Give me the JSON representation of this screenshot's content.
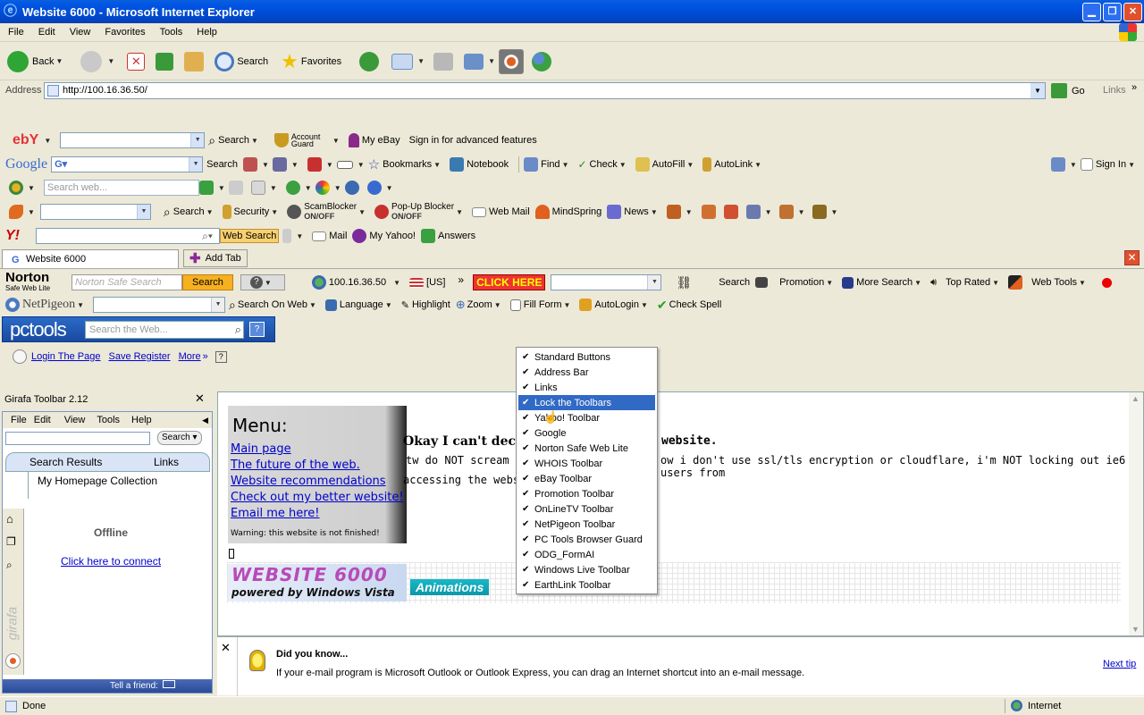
{
  "window": {
    "title": "Website 6000 - Microsoft Internet Explorer"
  },
  "menubar": [
    "File",
    "Edit",
    "View",
    "Favorites",
    "Tools",
    "Help"
  ],
  "std": {
    "back": "Back",
    "search": "Search",
    "favorites": "Favorites"
  },
  "address": {
    "label": "Address",
    "url": "http://100.16.36.50/",
    "go": "Go",
    "links": "Links"
  },
  "ebay": {
    "logo": "ebY",
    "search": "Search",
    "account_guard": "Account Guard",
    "my_ebay": "My eBay",
    "sign_in": "Sign in for advanced features"
  },
  "google": {
    "logo": "Google",
    "search": "Search",
    "bookmarks": "Bookmarks",
    "notebook": "Notebook",
    "find": "Find",
    "check": "Check",
    "autofill": "AutoFill",
    "autolink": "AutoLink",
    "signin": "Sign In"
  },
  "live": {
    "placeholder": "Search web..."
  },
  "earthlink": {
    "search": "Search",
    "security": "Security",
    "scamblocker": "ScamBlocker",
    "scam_state": "ON/OFF",
    "popup": "Pop-Up Blocker",
    "popup_state": "ON/OFF",
    "webmail": "Web Mail",
    "mindspring": "MindSpring",
    "news": "News"
  },
  "yahoo": {
    "logo": "Y!",
    "websearch": "Web Search",
    "mail": "Mail",
    "myyahoo": "My Yahoo!",
    "answers": "Answers"
  },
  "tabs": {
    "current": "Website 6000",
    "add": "Add Tab"
  },
  "norton": {
    "logo": "Norton",
    "sub": "Safe Web Lite",
    "placeholder": "Norton Safe Search",
    "search": "Search",
    "ip": "100.16.36.50",
    "country": "[US]",
    "click": "CLICK HERE",
    "search2": "Search",
    "promotion": "Promotion",
    "more_search": "More Search",
    "top_rated": "Top Rated",
    "web_tools": "Web Tools"
  },
  "netpigeon": {
    "logo": "NetPigeon",
    "search_web": "Search On Web",
    "language": "Language",
    "highlight": "Highlight",
    "zoom": "Zoom",
    "fill_form": "Fill Form",
    "autologin": "AutoLogin",
    "check_spell": "Check Spell"
  },
  "pctools": {
    "logo": "pctools",
    "placeholder": "Search the Web..."
  },
  "formai": {
    "login": "Login The Page",
    "save": "Save Register",
    "more": "More"
  },
  "girafa": {
    "title": "Girafa Toolbar 2.12",
    "menu": [
      "File",
      "Edit",
      "View",
      "Tools",
      "Help"
    ],
    "search": "Search",
    "tab_results": "Search Results",
    "tab_links": "Links",
    "collection": "My Homepage Collection",
    "offline": "Offline",
    "connect": "Click here to connect",
    "tell": "Tell a friend:",
    "brand": "girafa"
  },
  "page": {
    "menu_title": "Menu:",
    "links": [
      "Main page",
      "The future of the web.",
      "Website recommendations",
      "Check out my better website!",
      "Email me here!"
    ],
    "warning": "Warning: this website is not finished!",
    "heading": "Okay I can't deci",
    "heading2": "website.",
    "body1": "tw do NOT scream c",
    "body1b": "ow i don't use ssl/tls encryption or cloudflare, i'm NOT locking out ie6 users from",
    "body2": "accessing the website",
    "banner_top": "WEBSITE 6000",
    "banner_bottom": "powered by Windows Vista",
    "animations": "Animations"
  },
  "context_menu": [
    {
      "label": "Standard Buttons",
      "checked": true
    },
    {
      "label": "Address Bar",
      "checked": true
    },
    {
      "label": "Links",
      "checked": true
    },
    {
      "label": "Lock the Toolbars",
      "checked": true,
      "highlighted": true
    },
    {
      "label": "Yahoo! Toolbar",
      "checked": true
    },
    {
      "label": "Google",
      "checked": true
    },
    {
      "label": "Norton Safe Web Lite",
      "checked": true
    },
    {
      "label": "WHOIS Toolbar",
      "checked": true
    },
    {
      "label": "eBay Toolbar",
      "checked": true
    },
    {
      "label": "Promotion Toolbar",
      "checked": true
    },
    {
      "label": "OnLineTV Toolbar",
      "checked": true
    },
    {
      "label": "NetPigeon Toolbar",
      "checked": true
    },
    {
      "label": "PC Tools Browser Guard",
      "checked": true
    },
    {
      "label": "ODG_FormAI",
      "checked": true
    },
    {
      "label": "Windows Live Toolbar",
      "checked": true
    },
    {
      "label": "EarthLink Toolbar",
      "checked": true
    }
  ],
  "tip": {
    "title": "Did you know...",
    "text": "If your e-mail program is Microsoft Outlook or Outlook Express, you can drag an Internet shortcut into an e-mail message.",
    "next": "Next tip"
  },
  "status": {
    "left": "Done",
    "zone": "Internet"
  }
}
